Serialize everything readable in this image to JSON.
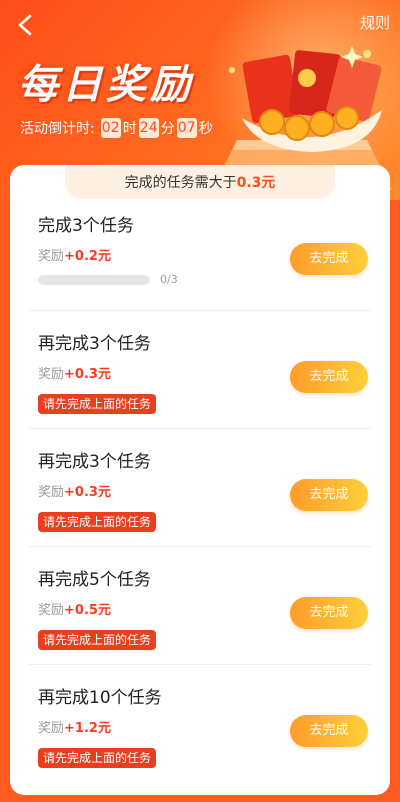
{
  "header": {
    "title": "每日奖励",
    "rules": "规则",
    "countdown": {
      "label": "活动倒计时:",
      "hours": "02",
      "hours_unit": "时",
      "minutes": "24",
      "minutes_unit": "分",
      "seconds": "07",
      "seconds_unit": "秒"
    }
  },
  "condition": {
    "text": "完成的任务需大于",
    "amount": "0.3元"
  },
  "tasks": [
    {
      "title": "完成3个任务",
      "reward_label": "奖励",
      "reward_amount": "+0.2元",
      "progress_text": "0/3",
      "progress_fraction": 0,
      "button": "去完成"
    },
    {
      "title": "再完成3个任务",
      "reward_label": "奖励",
      "reward_amount": "+0.3元",
      "tip": "请先完成上面的任务",
      "button": "去完成"
    },
    {
      "title": "再完成3个任务",
      "reward_label": "奖励",
      "reward_amount": "+0.3元",
      "tip": "请先完成上面的任务",
      "button": "去完成"
    },
    {
      "title": "再完成5个任务",
      "reward_label": "奖励",
      "reward_amount": "+0.5元",
      "tip": "请先完成上面的任务",
      "button": "去完成"
    },
    {
      "title": "再完成10个任务",
      "reward_label": "奖励",
      "reward_amount": "+1.2元",
      "tip": "请先完成上面的任务",
      "button": "去完成"
    }
  ],
  "colors": {
    "accent": "#ff4d1a",
    "button_start": "#ff9c2a",
    "button_end": "#ffcf3a",
    "tip_bg": "#e93f1f"
  },
  "icons": {
    "back": "chevron-left-icon",
    "illustration": "red-envelope-coins-illustration"
  }
}
